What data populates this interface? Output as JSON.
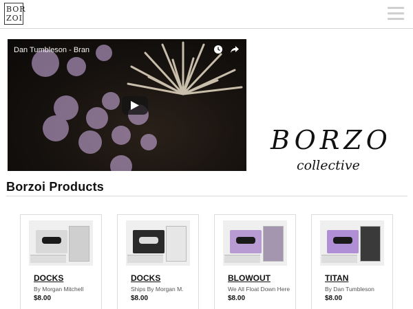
{
  "header": {
    "logo_line1": "BOR",
    "logo_line2": "ZOI",
    "menu_icon": "hamburger-icon"
  },
  "video": {
    "title": "Dan Tumbleson - Bran",
    "icons": [
      "clock-icon",
      "share-icon",
      "play-icon"
    ]
  },
  "brand": {
    "wordmark": "BORZOI",
    "tagline": "collective"
  },
  "section": {
    "title": "Borzoi Products"
  },
  "products": [
    {
      "name": "DOCKS",
      "subtitle": "By Morgan Mitchell",
      "price": "$8.00",
      "tape_color": "#d9d9d9",
      "case_color": "#b9b9b9"
    },
    {
      "name": "DOCKS",
      "subtitle": "Ships By Morgan M.",
      "price": "$8.00",
      "tape_color": "#2a2a2a",
      "case_color": "#c8c8c8"
    },
    {
      "name": "BLOWOUT",
      "subtitle": "We All Float Down Here",
      "price": "$8.00",
      "tape_color": "#b99bd3",
      "case_color": "#9c8aa8"
    },
    {
      "name": "TITAN",
      "subtitle": "By Dan Tumbleson",
      "price": "$8.00",
      "tape_color": "#b18fd6",
      "case_color": "#3a3a3a"
    }
  ],
  "colors": {
    "rule": "#d9d9d9",
    "card_border": "#dcdcdc",
    "menu_bars": "#cfcfcf"
  }
}
